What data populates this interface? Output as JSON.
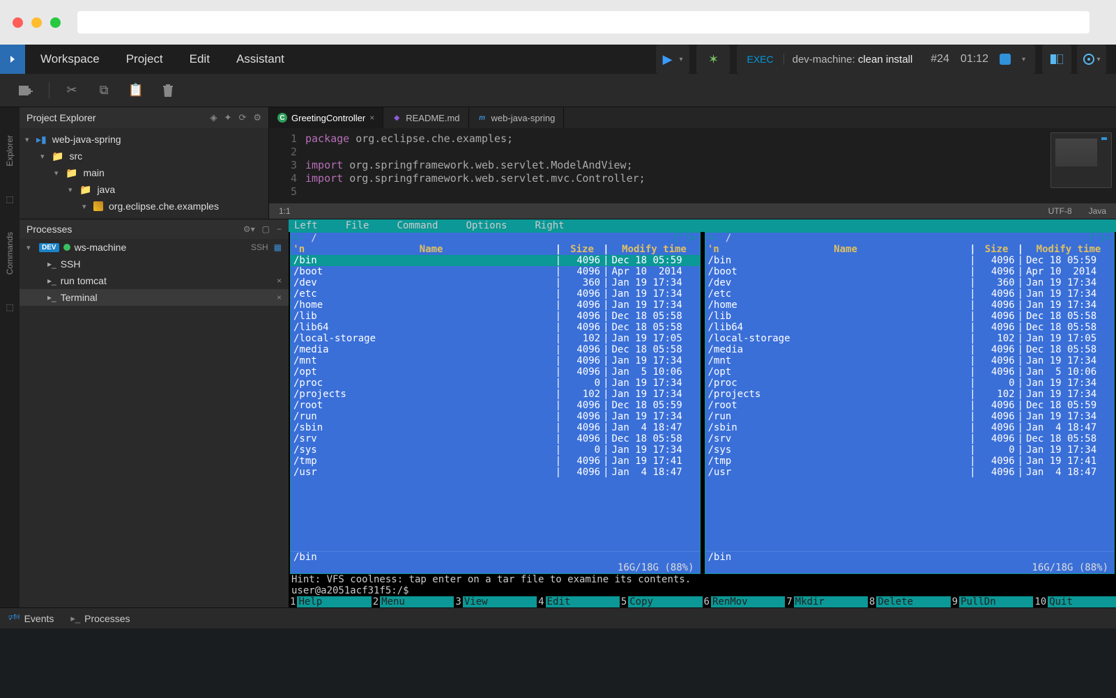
{
  "menu": {
    "workspace": "Workspace",
    "project": "Project",
    "edit": "Edit",
    "assistant": "Assistant"
  },
  "exec": {
    "label": "EXEC",
    "machine": "dev-machine: ",
    "command": "clean install",
    "run_id": "#24",
    "time": "01:12"
  },
  "panels": {
    "explorer_title": "Project Explorer",
    "processes_title": "Processes"
  },
  "project_tree": {
    "root": "web-java-spring",
    "src": "src",
    "main": "main",
    "java": "java",
    "package": "org.eclipse.che.examples"
  },
  "editor": {
    "tabs": [
      {
        "icon": "c",
        "label": "GreetingController",
        "close": true
      },
      {
        "icon": "md",
        "label": "README.md",
        "close": false
      },
      {
        "icon": "m",
        "label": "web-java-spring",
        "close": false
      }
    ],
    "code": {
      "l1_kw": "package",
      "l1_rest": " org.eclipse.che.examples;",
      "l3_kw": "import",
      "l3_rest": " org.springframework.web.servlet.ModelAndView;",
      "l4_kw": "import",
      "l4_rest": " org.springframework.web.servlet.mvc.Controller;"
    },
    "cursor": "1:1",
    "encoding": "UTF-8",
    "language": "Java"
  },
  "processes": {
    "machine": "ws-machine",
    "machine_badge": "DEV",
    "ssh_label": "SSH",
    "items": [
      {
        "label": "SSH",
        "close": false
      },
      {
        "label": "run tomcat",
        "close": true
      },
      {
        "label": "Terminal",
        "close": true
      }
    ]
  },
  "mc": {
    "menus": [
      "Left",
      "File",
      "Command",
      "Options",
      "Right"
    ],
    "path_left": "/",
    "path_right": "/",
    "corner": ".[^]>",
    "headers": {
      "n": "'n",
      "name": "Name",
      "size": "Size",
      "modify": "Modify time"
    },
    "rows": [
      {
        "name": "/bin",
        "size": "4096",
        "mod": "Dec 18 05:59"
      },
      {
        "name": "/boot",
        "size": "4096",
        "mod": "Apr 10  2014"
      },
      {
        "name": "/dev",
        "size": "360",
        "mod": "Jan 19 17:34"
      },
      {
        "name": "/etc",
        "size": "4096",
        "mod": "Jan 19 17:34"
      },
      {
        "name": "/home",
        "size": "4096",
        "mod": "Jan 19 17:34"
      },
      {
        "name": "/lib",
        "size": "4096",
        "mod": "Dec 18 05:58"
      },
      {
        "name": "/lib64",
        "size": "4096",
        "mod": "Dec 18 05:58"
      },
      {
        "name": "/local-storage",
        "size": "102",
        "mod": "Jan 19 17:05"
      },
      {
        "name": "/media",
        "size": "4096",
        "mod": "Dec 18 05:58"
      },
      {
        "name": "/mnt",
        "size": "4096",
        "mod": "Jan 19 17:34"
      },
      {
        "name": "/opt",
        "size": "4096",
        "mod": "Jan  5 10:06"
      },
      {
        "name": "/proc",
        "size": "0",
        "mod": "Jan 19 17:34"
      },
      {
        "name": "/projects",
        "size": "102",
        "mod": "Jan 19 17:34"
      },
      {
        "name": "/root",
        "size": "4096",
        "mod": "Dec 18 05:59"
      },
      {
        "name": "/run",
        "size": "4096",
        "mod": "Jan 19 17:34"
      },
      {
        "name": "/sbin",
        "size": "4096",
        "mod": "Jan  4 18:47"
      },
      {
        "name": "/srv",
        "size": "4096",
        "mod": "Dec 18 05:58"
      },
      {
        "name": "/sys",
        "size": "0",
        "mod": "Jan 19 17:34"
      },
      {
        "name": "/tmp",
        "size": "4096",
        "mod": "Jan 19 17:41"
      },
      {
        "name": "/usr",
        "size": "4096",
        "mod": "Jan  4 18:47"
      }
    ],
    "selected_left": "/bin",
    "selected_right": "/bin",
    "disk": "16G/18G (88%)",
    "hint": "Hint: VFS coolness: tap enter on a tar file to examine its contents.",
    "prompt": "user@a2051acf31f5:/$",
    "fkeys": [
      {
        "n": "1",
        "l": "Help"
      },
      {
        "n": "2",
        "l": "Menu"
      },
      {
        "n": "3",
        "l": "View"
      },
      {
        "n": "4",
        "l": "Edit"
      },
      {
        "n": "5",
        "l": "Copy"
      },
      {
        "n": "6",
        "l": "RenMov"
      },
      {
        "n": "7",
        "l": "Mkdir"
      },
      {
        "n": "8",
        "l": "Delete"
      },
      {
        "n": "9",
        "l": "PullDn"
      },
      {
        "n": "10",
        "l": "Quit"
      }
    ]
  },
  "bottom": {
    "events": "Events",
    "processes": "Processes"
  }
}
